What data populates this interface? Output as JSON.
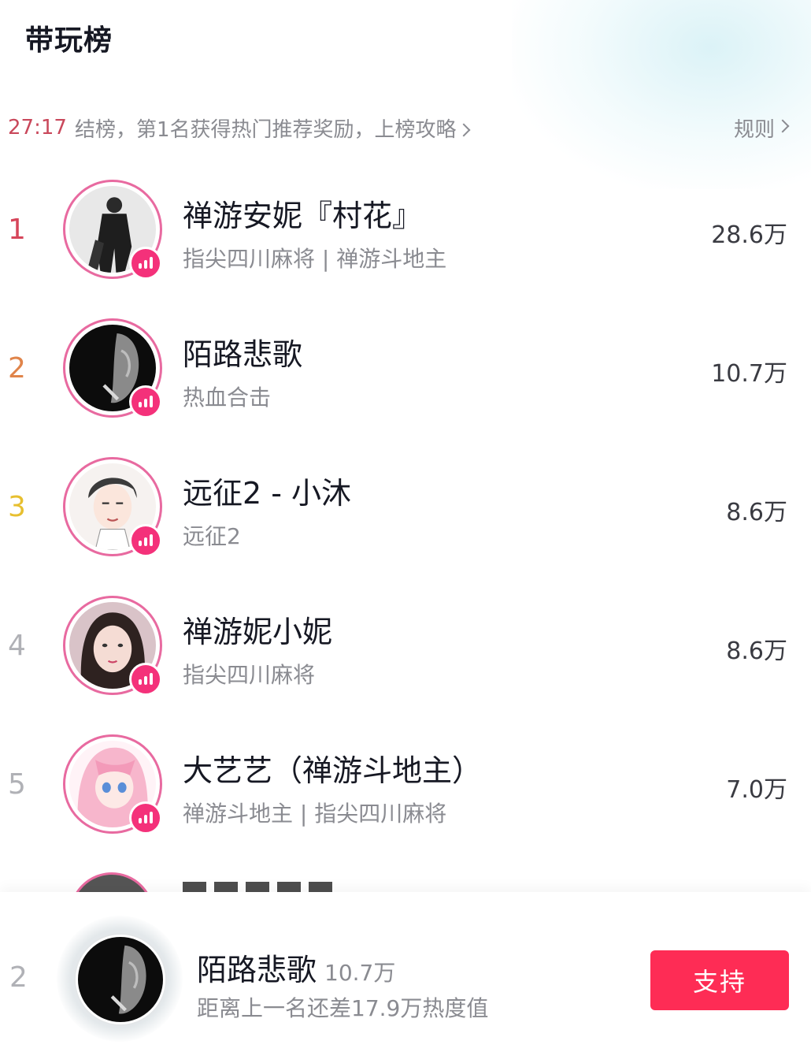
{
  "header": {
    "title": "带玩榜"
  },
  "info": {
    "timer": "27:17",
    "message": "结榜，第1名获得热门推荐奖励，上榜攻略",
    "rules_label": "规则"
  },
  "colors": {
    "accent": "#fe2c55",
    "live_badge": "#f4317a",
    "avatar_ring": "#e86aa0",
    "rank1": "#d6455a",
    "rank2": "#e0844a",
    "rank3": "#e7bf2f",
    "rank_other": "#b0b1b6"
  },
  "list": [
    {
      "rank": "1",
      "name": "禅游安妮『村花』",
      "tags": "指尖四川麻将 | 禅游斗地主",
      "score": "28.6万"
    },
    {
      "rank": "2",
      "name": "陌路悲歌",
      "tags": "热血合击",
      "score": "10.7万"
    },
    {
      "rank": "3",
      "name": "远征2 - 小沐",
      "tags": "远征2",
      "score": "8.6万"
    },
    {
      "rank": "4",
      "name": "禅游妮小妮",
      "tags": "指尖四川麻将",
      "score": "8.6万"
    },
    {
      "rank": "5",
      "name": "大艺艺（禅游斗地主）",
      "tags": "禅游斗地主 | 指尖四川麻将",
      "score": "7.0万"
    }
  ],
  "footer": {
    "rank": "2",
    "name": "陌路悲歌",
    "score": "10.7万",
    "subtitle": "距离上一名还差17.9万热度值",
    "button_label": "支持"
  }
}
